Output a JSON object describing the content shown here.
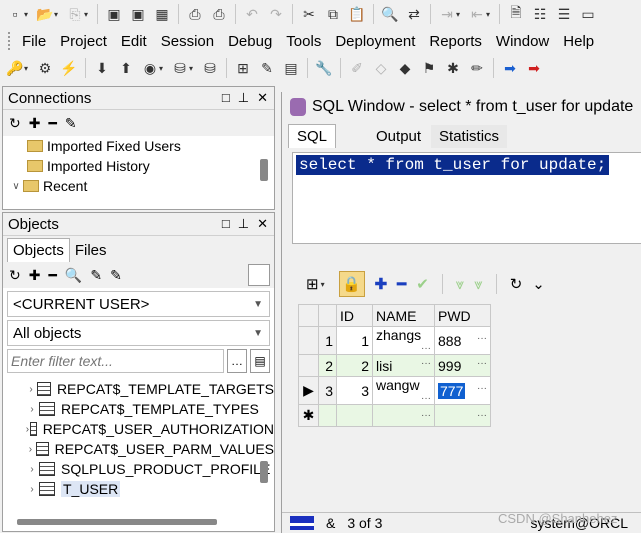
{
  "menu": [
    "File",
    "Project",
    "Edit",
    "Session",
    "Debug",
    "Tools",
    "Deployment",
    "Reports",
    "Window",
    "Help"
  ],
  "connections": {
    "title": "Connections",
    "items": [
      "Imported Fixed Users",
      "Imported History",
      "Recent"
    ]
  },
  "objects": {
    "title": "Objects",
    "tabs": [
      "Objects",
      "Files"
    ],
    "user_combo": "<CURRENT USER>",
    "type_combo": "All objects",
    "filter_placeholder": "Enter filter text...",
    "tables": [
      "REPCAT$_TEMPLATE_TARGETS",
      "REPCAT$_TEMPLATE_TYPES",
      "REPCAT$_USER_AUTHORIZATION",
      "REPCAT$_USER_PARM_VALUES",
      "SQLPLUS_PRODUCT_PROFILE",
      "T_USER"
    ]
  },
  "sql_window": {
    "title": "SQL Window - select * from t_user for update",
    "tabs": [
      "SQL",
      "Output",
      "Statistics"
    ],
    "query": "select * from t_user for update;"
  },
  "grid": {
    "columns": [
      "ID",
      "NAME",
      "PWD"
    ],
    "rows": [
      {
        "n": "1",
        "id": "1",
        "name": "zhangs",
        "pwd": "888"
      },
      {
        "n": "2",
        "id": "2",
        "name": "lisi",
        "pwd": "999"
      },
      {
        "n": "3",
        "id": "3",
        "name": "wangw",
        "pwd": "777"
      }
    ]
  },
  "status": {
    "record": "3 of 3",
    "connection": "system@ORCL",
    "watermark": "CSDN @Shanhehez"
  },
  "colors": {
    "selection": "#0a2b8c",
    "row_alt": "#e9f7e4",
    "cell_selected": "#1060d0"
  }
}
